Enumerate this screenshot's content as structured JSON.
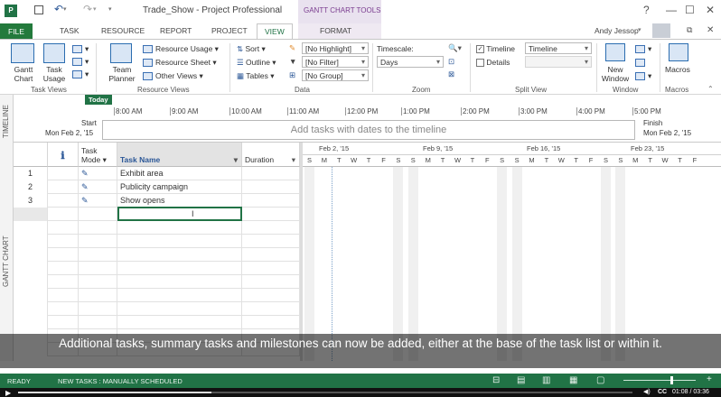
{
  "titlebar": {
    "title": "Trade_Show - Project Professional",
    "context_title": "GANTT CHART TOOLS",
    "help": "?",
    "minimize": "—",
    "maximize": "☐",
    "close": "✕"
  },
  "tabs": {
    "file": "FILE",
    "task": "TASK",
    "resource": "RESOURCE",
    "report": "REPORT",
    "project": "PROJECT",
    "view": "VIEW",
    "format": "FORMAT",
    "user": "Andy Jessop"
  },
  "ribbon": {
    "task_views": {
      "label": "Task Views",
      "gantt_chart": "Gantt Chart",
      "task_usage": "Task Usage"
    },
    "resource_views": {
      "label": "Resource Views",
      "team_planner": "Team Planner",
      "resource_usage": "Resource Usage",
      "resource_sheet": "Resource Sheet",
      "other_views": "Other Views"
    },
    "data": {
      "label": "Data",
      "sort": "Sort",
      "outline": "Outline",
      "tables": "Tables",
      "highlight": "[No Highlight]",
      "filter": "[No Filter]",
      "group": "[No Group]"
    },
    "zoom": {
      "label": "Zoom",
      "timescale_label": "Timescale:",
      "timescale_value": "Days"
    },
    "split_view": {
      "label": "Split View",
      "timeline_check": "Timeline",
      "timeline_value": "Timeline",
      "details_check": "Details"
    },
    "window": {
      "label": "Window",
      "new_window": "New Window"
    },
    "macros": {
      "label": "Macros",
      "macros": "Macros"
    }
  },
  "timeline": {
    "side_label": "TIMELINE",
    "today": "Today",
    "start_label": "Start",
    "start_date": "Mon Feb 2, '15",
    "finish_label": "Finish",
    "finish_date": "Mon Feb 2, '15",
    "placeholder": "Add tasks with dates to the timeline",
    "ticks": [
      "8:00 AM",
      "9:00 AM",
      "10:00 AM",
      "11:00 AM",
      "12:00 PM",
      "1:00 PM",
      "2:00 PM",
      "3:00 PM",
      "4:00 PM",
      "5:00 PM"
    ]
  },
  "gantt": {
    "side_label": "GANTT CHART",
    "headers": {
      "info": "ℹ",
      "task_mode": "Task Mode",
      "task_name": "Task Name",
      "duration": "Duration"
    },
    "rows": [
      {
        "id": "1",
        "name": "Exhibit area"
      },
      {
        "id": "2",
        "name": "Publicity campaign"
      },
      {
        "id": "3",
        "name": "Show opens"
      }
    ],
    "weeks": [
      "Feb 2, '15",
      "Feb 9, '15",
      "Feb 16, '15",
      "Feb 23, '15"
    ],
    "days": [
      "S",
      "M",
      "T",
      "W",
      "T",
      "F",
      "S",
      "S",
      "M",
      "T",
      "W",
      "T",
      "F",
      "S",
      "S",
      "M",
      "T",
      "W",
      "T",
      "F",
      "S",
      "S",
      "M",
      "T",
      "W",
      "T",
      "F"
    ]
  },
  "caption": "Additional tasks, summary tasks and milestones can now be added, either at the base of the task list or within it.",
  "status": {
    "ready": "READY",
    "new_tasks": "NEW TASKS : MANUALLY SCHEDULED",
    "time": "01:08 / 03:36",
    "cc": "CC"
  },
  "colors": {
    "accent": "#217346",
    "context": "#7a3c8f"
  }
}
